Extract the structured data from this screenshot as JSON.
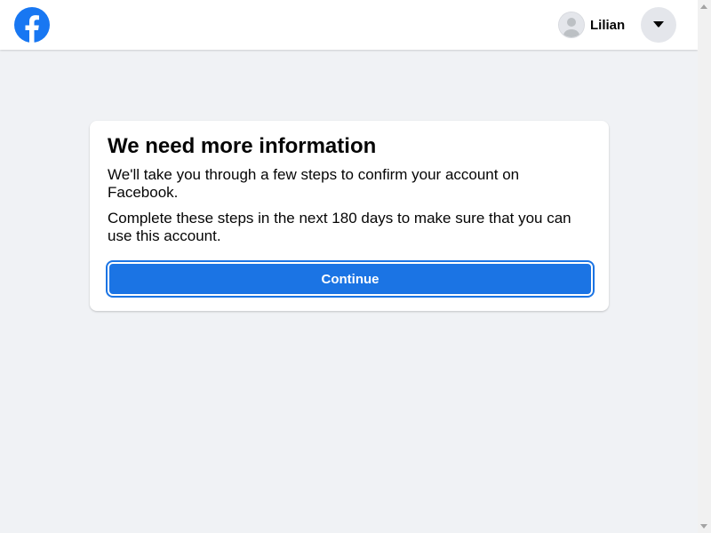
{
  "header": {
    "brand_icon": "facebook-logo-icon",
    "brand_color": "#1877f2",
    "profile": {
      "avatar_icon": "default-avatar-icon",
      "name": "Lilian"
    },
    "menu_icon": "caret-down-icon"
  },
  "card": {
    "title": "We need more information",
    "text1": "We'll take you through a few steps to confirm your account on Facebook.",
    "text2": "Complete these steps in the next 180 days to make sure that you can use this account.",
    "continue_label": "Continue",
    "button_color": "#1b74e4"
  },
  "scrollbar": {
    "up_icon": "scroll-up-arrow-icon",
    "down_icon": "scroll-down-arrow-icon"
  }
}
